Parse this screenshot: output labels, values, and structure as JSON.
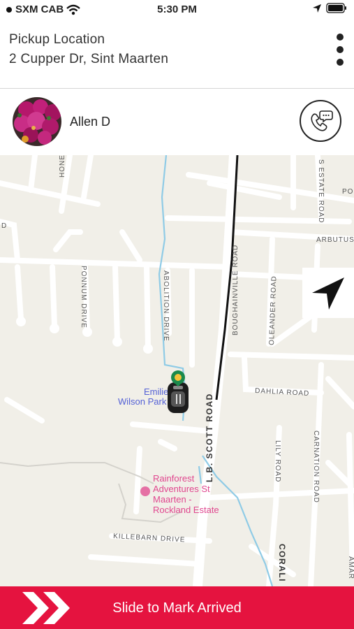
{
  "status_bar": {
    "carrier": "SXM CAB",
    "time": "5:30 PM"
  },
  "pickup": {
    "label": "Pickup Location",
    "address": "2 Cupper Dr, Sint Maarten"
  },
  "driver": {
    "name": "Allen D"
  },
  "map": {
    "streets": {
      "honey": "HONE",
      "s_estate": "S ESTATE ROAD",
      "po": "PO",
      "arbutus": "ARBUTUS",
      "d": "D",
      "ponnum": "PONNUM DRIVE",
      "abolition": "ABOLITION DRIVE",
      "boughainville": "BOUGHAINVILLE ROAD",
      "oleander": "OLEANDER ROAD",
      "dahlia": "DAHLIA ROAD",
      "lb_scott": "L.B. SCOTT ROAD",
      "lily": "LILY ROAD",
      "carnation": "CARNATION ROAD",
      "killebarn": "KILLEBARN DRIVE",
      "corali": "CORALI",
      "amar": "AMAR"
    },
    "pois": {
      "park": [
        "Emilie",
        "Wilson Park"
      ],
      "rainforest": [
        "Rainforest",
        "Adventures St",
        "Maarten -",
        "Rockland Estate"
      ]
    }
  },
  "slider": {
    "label": "Slide to Mark Arrived"
  },
  "colors": {
    "accent": "#e5133f",
    "map_bg": "#f1efe8",
    "water": "#8fcbe6",
    "pin": "#1b8a4c",
    "park_text": "#5461d6",
    "poi_text": "#e0468e"
  }
}
